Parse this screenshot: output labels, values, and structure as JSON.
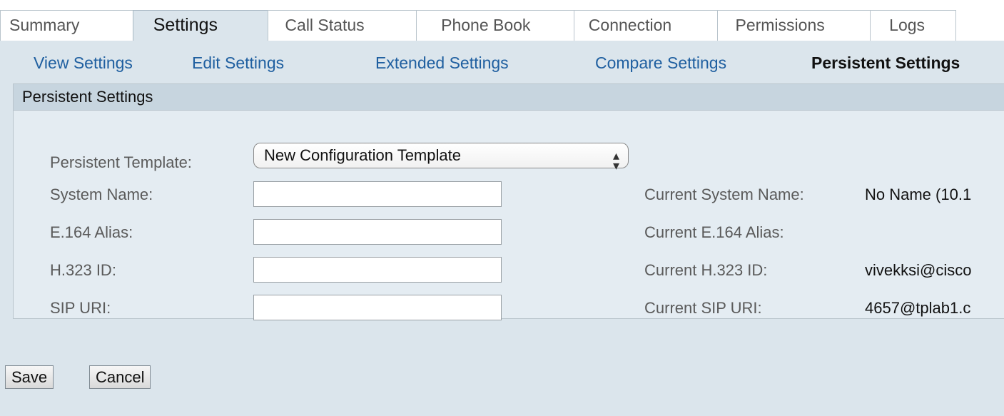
{
  "tabs": [
    {
      "label": "Summary"
    },
    {
      "label": "Settings",
      "active": true
    },
    {
      "label": "Call Status"
    },
    {
      "label": "Phone Book"
    },
    {
      "label": "Connection"
    },
    {
      "label": "Permissions"
    },
    {
      "label": "Logs"
    }
  ],
  "subnav": [
    {
      "label": "View Settings"
    },
    {
      "label": "Edit Settings"
    },
    {
      "label": "Extended Settings"
    },
    {
      "label": "Compare Settings"
    },
    {
      "label": "Persistent Settings",
      "active": true
    }
  ],
  "panel": {
    "title": "Persistent Settings",
    "template_label": "Persistent Template:",
    "template_value": "New Configuration Template",
    "fields": [
      {
        "label": "System Name:",
        "value": "",
        "current_label": "Current System Name:",
        "current_value": "No Name (10.1"
      },
      {
        "label": "E.164 Alias:",
        "value": "",
        "current_label": "Current E.164 Alias:",
        "current_value": ""
      },
      {
        "label": "H.323 ID:",
        "value": "",
        "current_label": "Current H.323 ID:",
        "current_value": "vivekksi@cisco"
      },
      {
        "label": "SIP URI:",
        "value": "",
        "current_label": "Current SIP URI:",
        "current_value": "4657@tplab1.c"
      }
    ]
  },
  "buttons": {
    "save": "Save",
    "cancel": "Cancel"
  },
  "colors": {
    "link": "#1f5fa0",
    "panel_header": "#c7d5df",
    "background": "#dbe5ec"
  },
  "icons": {
    "select_arrow": "up-down-chevron-icon"
  }
}
